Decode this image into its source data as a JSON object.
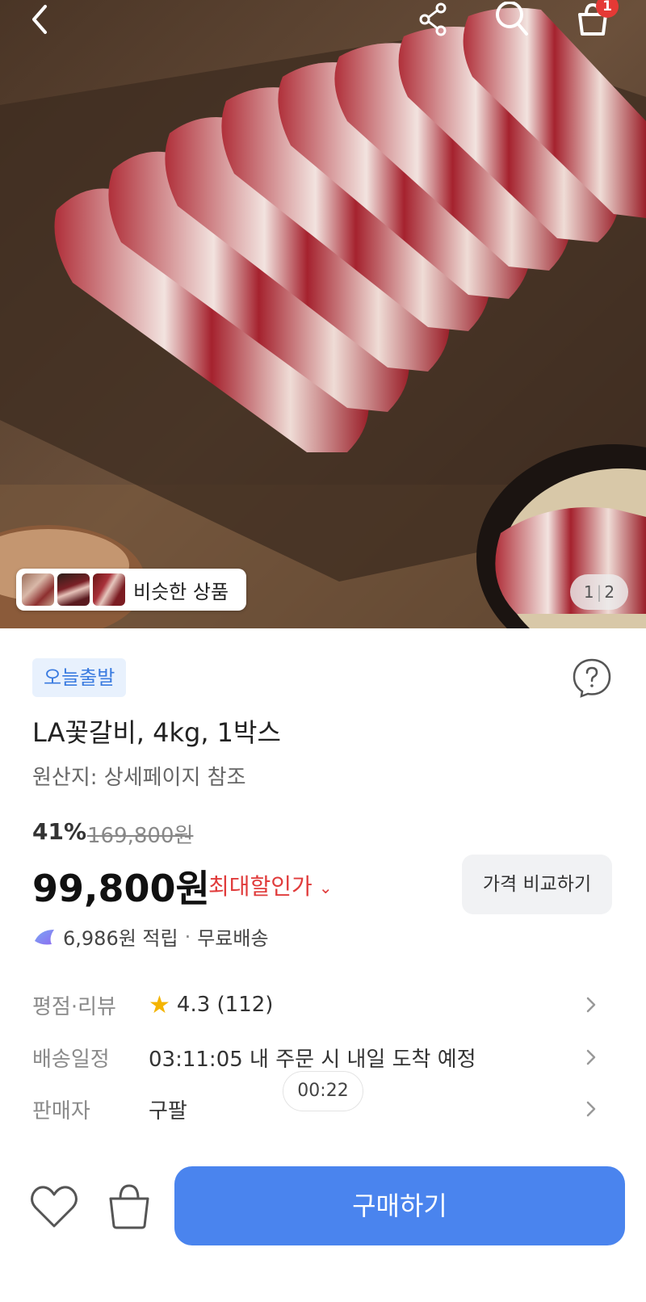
{
  "header": {
    "cart_count": "1",
    "icons": [
      "back-arrow-icon",
      "share-icon",
      "search-icon",
      "cart-icon"
    ]
  },
  "gallery": {
    "similar_label": "비슷한 상품",
    "page_current": "1",
    "page_total": "2"
  },
  "product": {
    "badge": "오늘출발",
    "title": "LA꽃갈비, 4kg, 1박스",
    "origin": "원산지: 상세페이지 참조"
  },
  "pricing": {
    "discount": "41%",
    "original_price": "169,800원",
    "price": "99,800원",
    "max_discount_label": "최대할인가",
    "compare_button": "가격 비교하기",
    "reward": "6,986원 적립",
    "reward_sep": "·",
    "shipping": "무료배송"
  },
  "info_rows": {
    "rating": {
      "label": "평점·리뷰",
      "score": "4.3",
      "count": "(112)"
    },
    "delivery": {
      "label": "배송일정",
      "value": "03:11:05 내 주문 시 내일 도착 예정"
    },
    "seller": {
      "label": "판매자",
      "value": "구팔"
    }
  },
  "timer": "00:22",
  "bottom": {
    "buy_button": "구매하기"
  },
  "colors": {
    "accent": "#4a84ee",
    "badge_bg": "#e8f1fd",
    "badge_text": "#3a7be0",
    "sale_red": "#e03b3b",
    "star": "#f4b400",
    "cart_badge": "#e53935"
  }
}
